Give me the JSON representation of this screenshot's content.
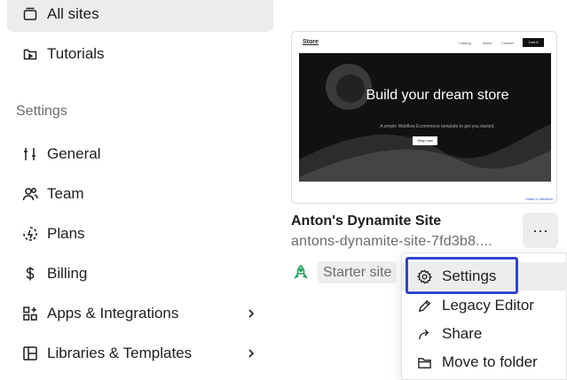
{
  "sidebar": {
    "all_sites": "All sites",
    "tutorials": "Tutorials",
    "section_title": "Settings",
    "items": [
      {
        "label": "General",
        "icon": "sliders-icon"
      },
      {
        "label": "Team",
        "icon": "users-icon"
      },
      {
        "label": "Plans",
        "icon": "plans-icon"
      },
      {
        "label": "Billing",
        "icon": "dollar-icon"
      },
      {
        "label": "Apps & Integrations",
        "icon": "apps-icon"
      },
      {
        "label": "Libraries & Templates",
        "icon": "library-icon"
      }
    ]
  },
  "site": {
    "thumbnail": {
      "logo": "Store",
      "links": [
        "Catalog",
        "About",
        "Contact"
      ],
      "cart": "Cart 0",
      "headline": "Build your dream store",
      "subtext": "A simple Webflow Ecommerce template to get you started.",
      "button": "Shop now",
      "badge": "Made in Webflow"
    },
    "name": "Anton's Dynamite Site",
    "url": "antons-dynamite-site-7fd3b8....",
    "more_label": "···",
    "plan": "Starter site",
    "plan_color": "#1f9d55"
  },
  "context_menu": {
    "items": [
      {
        "label": "Settings",
        "icon": "gear-icon"
      },
      {
        "label": "Legacy Editor",
        "icon": "pencil-icon"
      },
      {
        "label": "Share",
        "icon": "share-arrow-icon"
      },
      {
        "label": "Move to folder",
        "icon": "folder-icon"
      }
    ],
    "focus_color": "#3344cc"
  }
}
